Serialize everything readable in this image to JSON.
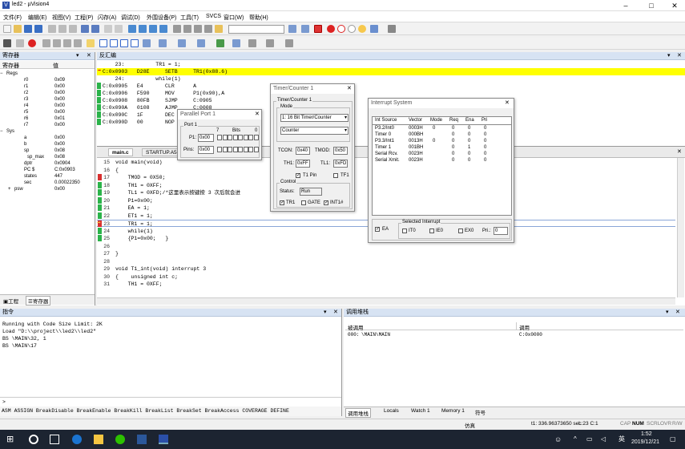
{
  "title": "led2 - µVision4",
  "menu": [
    "文件(F)",
    "编辑(E)",
    "视图(V)",
    "工程(P)",
    "闪存(A)",
    "调试(D)",
    "外围设备(P)",
    "工具(T)",
    "SVCS",
    "窗口(W)",
    "帮助(H)"
  ],
  "regs": {
    "title": "寄存器",
    "col1": "寄存器",
    "col2": "值",
    "rows": [
      {
        "n": "Regs",
        "v": "",
        "ind": 0
      },
      {
        "n": "r0",
        "v": "0x09",
        "ind": 2
      },
      {
        "n": "r1",
        "v": "0x00",
        "ind": 2
      },
      {
        "n": "r2",
        "v": "0x00",
        "ind": 2
      },
      {
        "n": "r3",
        "v": "0x00",
        "ind": 2
      },
      {
        "n": "r4",
        "v": "0x00",
        "ind": 2
      },
      {
        "n": "r5",
        "v": "0x00",
        "ind": 2
      },
      {
        "n": "r6",
        "v": "0x01",
        "ind": 2
      },
      {
        "n": "r7",
        "v": "0x00",
        "ind": 2
      },
      {
        "n": "Sys",
        "v": "",
        "ind": 0
      },
      {
        "n": "a",
        "v": "0x00",
        "ind": 2
      },
      {
        "n": "b",
        "v": "0x00",
        "ind": 2
      },
      {
        "n": "sp",
        "v": "0x08",
        "ind": 2
      },
      {
        "n": "sp_max",
        "v": "0x08",
        "ind": 3
      },
      {
        "n": "dptr",
        "v": "0x0904",
        "ind": 2
      },
      {
        "n": "PC  $",
        "v": "C:0x0903",
        "ind": 2
      },
      {
        "n": "states",
        "v": "447",
        "ind": 2
      },
      {
        "n": "sec",
        "v": "0.00022350",
        "ind": 2
      },
      {
        "n": "psw",
        "v": "0x00",
        "ind": 1
      }
    ],
    "tab_project": "工程",
    "tab_regs": "寄存器"
  },
  "disasm": {
    "title": "反汇编",
    "lines": [
      {
        "t": "    23:          TR1 = 1;",
        "hl": false,
        "mk": false
      },
      {
        "t": "C:0x0903   D28E     SETB     TR1(0x88.6)",
        "hl": true,
        "mk": false
      },
      {
        "t": "    24:          while(1)",
        "hl": false,
        "mk": false
      },
      {
        "t": "C:0x0905   E4       CLR      A",
        "hl": false,
        "mk": true
      },
      {
        "t": "C:0x0906   F590     MOV      P1(0x90),A",
        "hl": false,
        "mk": true
      },
      {
        "t": "C:0x0908   80FB     SJMP     C:0905",
        "hl": false,
        "mk": true
      },
      {
        "t": "C:0x090A   0108     AJMP     C:0008",
        "hl": false,
        "mk": true
      },
      {
        "t": "C:0x090C   1F       DEC      R7",
        "hl": false,
        "mk": true
      },
      {
        "t": "C:0x090D   00       NOP",
        "hl": false,
        "mk": true
      }
    ]
  },
  "editor": {
    "tabs": [
      "main.c",
      "STARTUP.A51"
    ],
    "lines": [
      {
        "n": "15",
        "t": "void main(void)",
        "g": "none",
        "cur": false
      },
      {
        "n": "16",
        "t": "{",
        "g": "none",
        "cur": false
      },
      {
        "n": "17",
        "t": "    TMOD = 0X50;",
        "g": "red",
        "cur": false
      },
      {
        "n": "18",
        "t": "    TH1 = 0XFF;",
        "g": "green",
        "cur": false
      },
      {
        "n": "19",
        "t": "    TL1 = 0XFD;/*这里表示按键按 3 次后就会进",
        "g": "green",
        "cur": false
      },
      {
        "n": "20",
        "t": "    P1=0x00;",
        "g": "green",
        "cur": false
      },
      {
        "n": "21",
        "t": "    EA = 1;",
        "g": "green",
        "cur": false
      },
      {
        "n": "22",
        "t": "    ET1 = 1;",
        "g": "green",
        "cur": false
      },
      {
        "n": "23",
        "t": "    TR1 = 1;",
        "g": "arrow",
        "cur": true
      },
      {
        "n": "24",
        "t": "    while(1)",
        "g": "green",
        "cur": false
      },
      {
        "n": "25",
        "t": "    {P1=0x00;   }",
        "g": "green",
        "cur": false
      },
      {
        "n": "26",
        "t": "",
        "g": "none",
        "cur": false
      },
      {
        "n": "27",
        "t": "}",
        "g": "none",
        "cur": false
      },
      {
        "n": "28",
        "t": "",
        "g": "none",
        "cur": false
      },
      {
        "n": "29",
        "t": "void T1_int(void) interrupt 3",
        "g": "none",
        "cur": false
      },
      {
        "n": "30",
        "t": "{    unsigned int c;",
        "g": "none",
        "cur": false
      },
      {
        "n": "31",
        "t": "    TH1 = 0XFF;",
        "g": "none",
        "cur": false
      }
    ]
  },
  "port": {
    "title": "Parallel Port 1",
    "grp": "Port 1",
    "p1_label": "P1:",
    "p1_val": "0x00",
    "pins_label": "Pins:",
    "pins_val": "0x00",
    "bits_label": "Bits",
    "bit7": "7",
    "bit0": "0"
  },
  "timer": {
    "title": "Timer/Counter 1",
    "grp": "Timer/Counter 1",
    "mode_grp": "Mode",
    "mode_val": "1: 16 Bit Timer/Counter",
    "type_val": "Counter",
    "tcon_label": "TCON:",
    "tcon_val": "0x40",
    "tmod_label": "TMOD:",
    "tmod_val": "0x50",
    "th1_label": "TH1:",
    "th1_val": "0xFF",
    "tl1_label": "TL1:",
    "tl1_val": "0xFD",
    "t1pin": "T1 Pin",
    "tf1": "TF1",
    "ctrl_grp": "Control",
    "status_label": "Status:",
    "status_val": "Run",
    "tr1": "TR1",
    "gate": "GATE",
    "int1": "INT1#"
  },
  "intr": {
    "title": "Interrupt System",
    "cols": [
      "Int Source",
      "Vector",
      "Mode",
      "Req",
      "Ena",
      "Pri"
    ],
    "rows": [
      [
        "P3.2/Int0",
        "0003H",
        "0",
        "0",
        "0",
        "0"
      ],
      [
        "Timer 0",
        "000BH",
        "",
        "0",
        "0",
        "0"
      ],
      [
        "P3.3/Int1",
        "0013H",
        "0",
        "0",
        "0",
        "0"
      ],
      [
        "Timer 1",
        "001BH",
        "",
        "0",
        "1",
        "0"
      ],
      [
        "Serial Rcv.",
        "0023H",
        "",
        "0",
        "0",
        "0"
      ],
      [
        "Serial Xmit.",
        "0023H",
        "",
        "0",
        "0",
        "0"
      ]
    ],
    "ea": "EA",
    "sel_grp": "Selected Interrupt",
    "it0": "IT0",
    "ie0": "IE0",
    "ex0": "EX0",
    "pri_label": "Pri.:",
    "pri_val": "0"
  },
  "cmd": {
    "title": "指令",
    "lines": [
      "Running with Code Size Limit: 2K",
      "Load \"D:\\\\project\\\\led2\\\\led2\"",
      "BS \\MAIN\\32, 1",
      "BS \\MAIN\\17"
    ],
    "prompt": ">",
    "help": "ASM ASSIGN BreakDisable BreakEnable BreakKill BreakList BreakSet BreakAccess COVERAGE DEFINE"
  },
  "callstack": {
    "title": "调用堆栈",
    "col1": "被调用",
    "col2": "调用",
    "row_idx": "000:",
    "row_callee": "\\MAIN\\MAIN",
    "row_caller": "C:0x0000",
    "tabs": [
      "调用堆栈",
      "Locals",
      "Watch 1",
      "Memory 1",
      "符号"
    ]
  },
  "status": {
    "mode": "仿真",
    "time": "t1: 336.96373650 sec",
    "pos": "L:23 C:1",
    "caps": "CAP",
    "num": "NUM",
    "scrl": "SCRL",
    "ovr": "OVR",
    "rw": "R/W"
  },
  "taskbar": {
    "ime": "英",
    "time": "1:52",
    "date": "2019/12/21"
  }
}
